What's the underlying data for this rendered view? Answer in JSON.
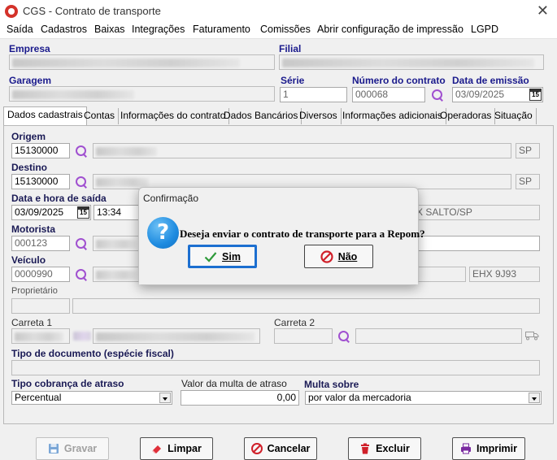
{
  "window": {
    "title": "CGS - Contrato de transporte"
  },
  "menu": [
    "Saída",
    "Cadastros",
    "Baixas",
    "Integrações",
    "Faturamento",
    "Comissões",
    "Abrir configuração de impressão",
    "LGPD"
  ],
  "header": {
    "empresa_label": "Empresa",
    "filial_label": "Filial",
    "garagem_label": "Garagem",
    "serie_label": "Série",
    "serie_value": "1",
    "numero_label": "Número do contrato",
    "numero_value": "000068",
    "emissao_label": "Data de emissão",
    "emissao_value": "03/09/2025"
  },
  "tabs": [
    "Dados cadastrais",
    "Contas",
    "Informações do contrato",
    "Dados Bancários",
    "Diversos",
    "Informações adicionais",
    "Operadoras",
    "Situação"
  ],
  "form": {
    "origem_label": "Origem",
    "origem_code": "15130000",
    "origem_uf": "SP",
    "destino_label": "Destino",
    "destino_code": "15130000",
    "destino_uf": "SP",
    "saida_label": "Data e hora de saída",
    "saida_date": "03/09/2025",
    "saida_time": "13:34",
    "saida_city_partial": "X SALTO/SP",
    "motorista_label": "Motorista",
    "motorista_code": "000123",
    "veiculo_label": "Veículo",
    "veiculo_code": "0000990",
    "veiculo_plate": "EHX 9J93",
    "proprietario_label": "Proprietário",
    "carreta1_label": "Carreta 1",
    "carreta2_label": "Carreta 2",
    "tipo_doc_label": "Tipo de documento (espécie fiscal)",
    "cobranca_label": "Tipo cobrança de atraso",
    "cobranca_value": "Percentual",
    "multa_label": "Valor da multa de atraso",
    "multa_value": "0,00",
    "multa_sobre_label": "Multa sobre",
    "multa_sobre_value": "por valor da mercadoria"
  },
  "buttons": {
    "gravar": "Gravar",
    "limpar": "Limpar",
    "cancelar": "Cancelar",
    "excluir": "Excluir",
    "imprimir": "Imprimir"
  },
  "dialog": {
    "title": "Confirmação",
    "message": "Deseja enviar o contrato de transporte para a Repom?",
    "yes": "Sim",
    "no": "Não"
  },
  "colors": {
    "label_dark": "#1a1a55",
    "search_purple": "#a050d0",
    "focus_blue": "#1c6fd0"
  }
}
